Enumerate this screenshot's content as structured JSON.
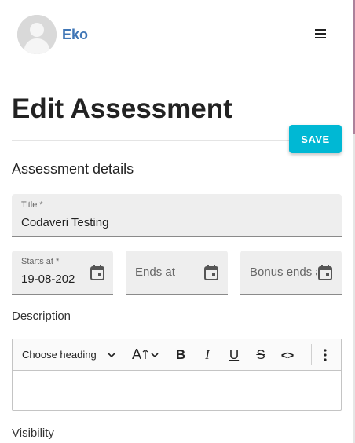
{
  "user": {
    "name": "Eko"
  },
  "page": {
    "title": "Edit Assessment",
    "save_label": "SAVE"
  },
  "details": {
    "section_title": "Assessment details",
    "title_field": {
      "label": "Title *",
      "value": "Codaveri Testing"
    },
    "starts_at": {
      "label": "Starts at *",
      "value": "19-08-202"
    },
    "ends_at": {
      "placeholder": "Ends at"
    },
    "bonus_ends_at": {
      "placeholder": "Bonus ends a"
    }
  },
  "description": {
    "label": "Description",
    "toolbar": {
      "heading": "Choose heading",
      "font_size": "A",
      "bold": "B",
      "italic": "I",
      "underline": "U",
      "strike": "S",
      "code": "<>"
    }
  },
  "visibility": {
    "label": "Visibility"
  },
  "colors": {
    "accent": "#00b8d4",
    "user_name": "#3f76b6"
  }
}
